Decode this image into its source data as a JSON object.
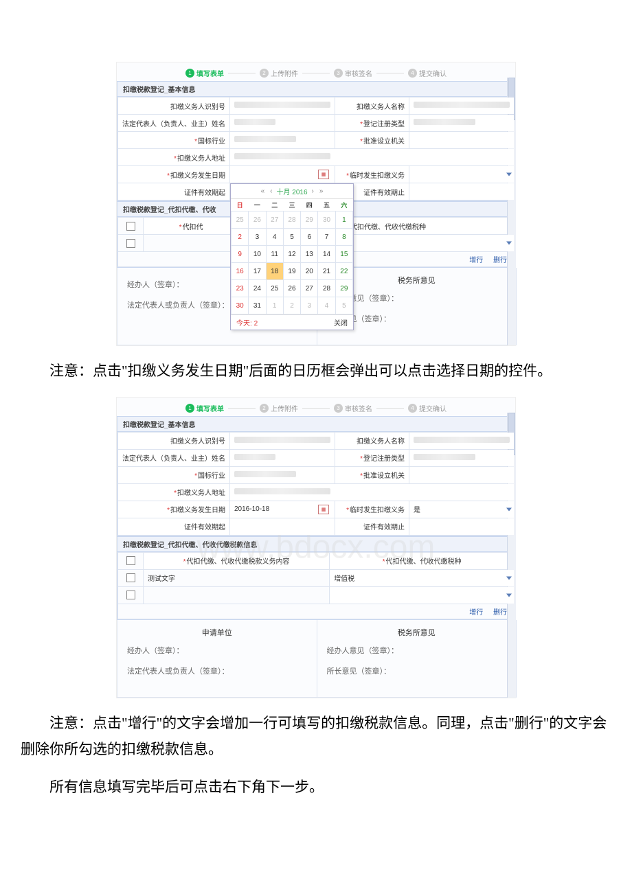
{
  "steps": [
    "填写表单",
    "上传附件",
    "审核签名",
    "提交确认"
  ],
  "section1_title": "扣缴税款登记_基本信息",
  "section2_title_a": "扣缴税款登记_代扣代缴、代收",
  "section2_title_b": "扣缴税款登记_代扣代缴、代收代缴税款信息",
  "labels": {
    "id": "扣缴义务人识别号",
    "name": "扣缴义务人名称",
    "legal": "法定代表人（负责人、业主）姓名",
    "regtype": "登记注册类型",
    "industry": "国标行业",
    "approval": "批准设立机关",
    "addr": "扣缴义务人地址",
    "date": "扣缴义务发生日期",
    "temp": "临时发生扣缴义务",
    "valid_from": "证件有效期起",
    "valid_to": "证件有效期止",
    "col_content": "代扣代缴、代收代缴税款义务内容",
    "col_content_short": "容",
    "col_tax": "代扣代缴、代收代缴税种",
    "col_sub": "代扣代"
  },
  "values": {
    "date": "2016-10-18",
    "temp": "是",
    "row_text": "测试文字",
    "row_tax": "增值税"
  },
  "actions": {
    "add": "增行",
    "del": "删行"
  },
  "sig": {
    "applicant": "申请单位",
    "tax_office": "税务所意见",
    "handler": "经办人（签章）：",
    "handler_op": "经办人意见（签章）：",
    "legal_rep": "法定代表人或负责人（签章）：",
    "chief": "所长意见（签章）："
  },
  "datepicker": {
    "month": "十月 2016",
    "weekdays": [
      "日",
      "一",
      "二",
      "三",
      "四",
      "五",
      "六"
    ],
    "today_label": "今天:",
    "today_num": "2",
    "close": "关闭"
  },
  "paragraphs": {
    "p1": "注意：点击\"扣缴义务发生日期\"后面的日历框会弹出可以点击选择日期的控件。",
    "p2": "注意：点击\"增行\"的文字会增加一行可填写的扣缴税款信息。同理，点击\"删行\"的文字会删除你所勾选的扣缴税款信息。",
    "p3": "所有信息填写完毕后可点击右下角下一步。"
  },
  "watermark": "www.bdocx.com"
}
